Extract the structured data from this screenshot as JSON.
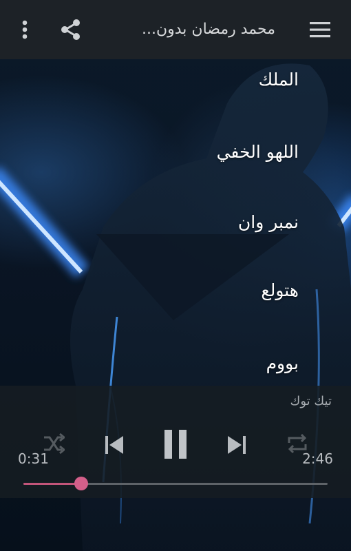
{
  "header": {
    "title": "محمد رمضان بدون...",
    "icons": {
      "more": "more-vert-icon",
      "share": "share-icon",
      "menu": "hamburger-menu-icon"
    }
  },
  "songs": [
    {
      "title": "الملك"
    },
    {
      "title": "اللهو الخفي"
    },
    {
      "title": "نمبر وان"
    },
    {
      "title": "هتولع"
    },
    {
      "title": "بووم"
    }
  ],
  "player": {
    "now_playing": "تيك توك",
    "elapsed": "0:31",
    "duration": "2:46",
    "progress_fraction": 0.19,
    "shuffle_enabled": false,
    "repeat_enabled": false,
    "state": "playing",
    "icons": {
      "shuffle": "shuffle-icon",
      "previous": "skip-previous-icon",
      "pause": "pause-icon",
      "next": "skip-next-icon",
      "repeat": "repeat-icon"
    }
  },
  "colors": {
    "topbar": "#1d2227",
    "accent": "#c2557a",
    "text_primary": "#ffffff",
    "text_secondary": "#a8adb2"
  }
}
